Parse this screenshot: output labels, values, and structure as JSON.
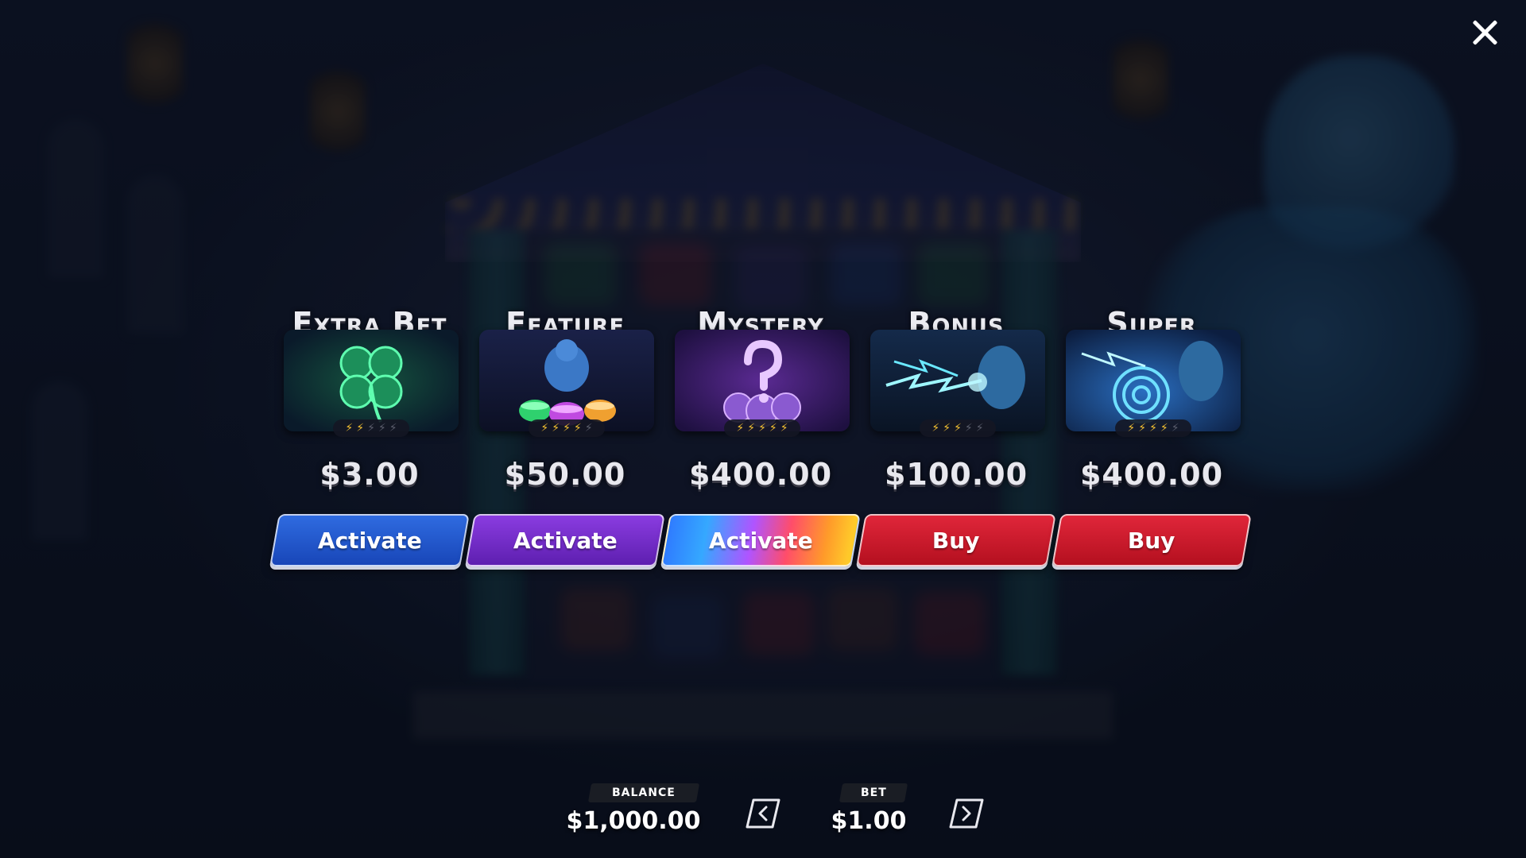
{
  "close": {
    "icon": "close-icon"
  },
  "cards": [
    {
      "title": "Extra Bet",
      "price": "$3.00",
      "button": "Activate",
      "button_style": "blue",
      "volatility": 2,
      "image": "four-leaf-clover"
    },
    {
      "title": "Feature",
      "price": "$50.00",
      "button": "Activate",
      "button_style": "purple",
      "volatility": 4,
      "image": "genie-with-cauldrons"
    },
    {
      "title": "Mystery",
      "price": "$400.00",
      "button": "Activate",
      "button_style": "rainbow",
      "volatility": 5,
      "image": "question-mark-cloud"
    },
    {
      "title": "Bonus",
      "price": "$100.00",
      "button": "Buy",
      "button_style": "red",
      "volatility": 3,
      "image": "genie-lightning"
    },
    {
      "title": "Super",
      "price": "$400.00",
      "button": "Buy",
      "button_style": "red",
      "volatility": 4,
      "image": "genie-vortex"
    }
  ],
  "volatility_max": 5,
  "footer": {
    "balance_label": "BALANCE",
    "balance_value": "$1,000.00",
    "bet_label": "BET",
    "bet_value": "$1.00",
    "decrease_icon": "chevron-left-icon",
    "increase_icon": "chevron-right-icon"
  },
  "colors": {
    "blue": "#1f55cf",
    "purple": "#7230c8",
    "red": "#cc1a2c",
    "bolt_on": "#f5c232",
    "bolt_off": "#5b5e6c"
  }
}
